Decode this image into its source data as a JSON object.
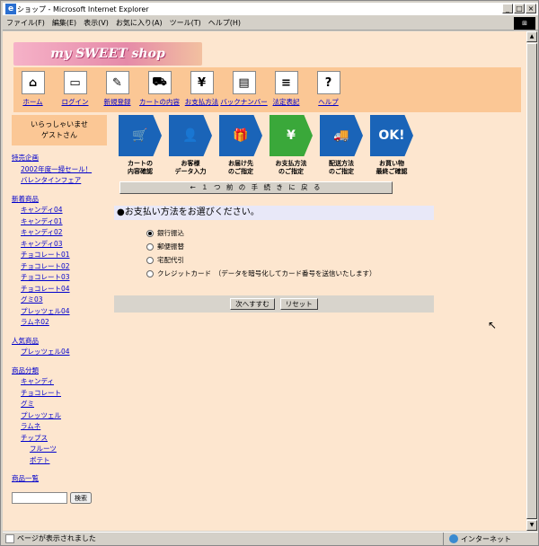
{
  "window": {
    "title": "ショップ - Microsoft Internet Explorer"
  },
  "menu": [
    "ファイル(F)",
    "編集(E)",
    "表示(V)",
    "お気に入り(A)",
    "ツール(T)",
    "ヘルプ(H)"
  ],
  "logo": "my SWEET shop",
  "nav": [
    {
      "label": "ホーム",
      "icon": "house-icon",
      "glyph": "⌂"
    },
    {
      "label": "ログイン",
      "icon": "login-icon",
      "glyph": "▭"
    },
    {
      "label": "新規登録",
      "icon": "register-icon",
      "glyph": "✎"
    },
    {
      "label": "カートの内容",
      "icon": "cart-icon",
      "glyph": "⛟"
    },
    {
      "label": "お支払方法",
      "icon": "payment-icon",
      "glyph": "¥"
    },
    {
      "label": "バックナンバー",
      "icon": "magazine-icon",
      "glyph": "▤"
    },
    {
      "label": "法定表記",
      "icon": "document-icon",
      "glyph": "≡"
    },
    {
      "label": "ヘルプ",
      "icon": "help-icon",
      "glyph": "?"
    }
  ],
  "sidebar": {
    "greet1": "いらっしゃいませ",
    "greet2": "ゲストさん",
    "special_title": "特売企画",
    "special": [
      "2002年度一掃セール！",
      "バレンタインフェア"
    ],
    "new_title": "新着商品",
    "new": [
      "キャンディ04",
      "キャンディ01",
      "キャンディ02",
      "キャンディ03",
      "チョコレート01",
      "チョコレート02",
      "チョコレート03",
      "チョコレート04",
      "グミ03",
      "プレッツェル04",
      "ラムネ02"
    ],
    "popular_title": "人気商品",
    "popular": [
      "プレッツェル04"
    ],
    "category_title": "商品分類",
    "categories": [
      "キャンディ",
      "チョコレート",
      "グミ",
      "プレッツェル",
      "ラムネ",
      "チップス"
    ],
    "subcategories": [
      "フルーツ",
      "ポテト"
    ],
    "all_products": "商品一覧",
    "search_button": "検索"
  },
  "steps": [
    {
      "label1": "カートの",
      "label2": "内容確認",
      "icon": "cart-step-icon",
      "glyph": "🛒",
      "active": false
    },
    {
      "label1": "お客様",
      "label2": "データ入力",
      "icon": "person-step-icon",
      "glyph": "👤",
      "active": false
    },
    {
      "label1": "お届け先",
      "label2": "のご指定",
      "icon": "gift-step-icon",
      "glyph": "🎁",
      "active": false
    },
    {
      "label1": "お支払方法",
      "label2": "のご指定",
      "icon": "card-step-icon",
      "glyph": "¥",
      "active": true
    },
    {
      "label1": "配送方法",
      "label2": "のご指定",
      "icon": "truck-step-icon",
      "glyph": "🚚",
      "active": false
    },
    {
      "label1": "お買い物",
      "label2": "最終ご確認",
      "icon": "ok-step-icon",
      "glyph": "OK!",
      "active": false
    }
  ],
  "back": "← １ つ 前 の 手 続 き に 戻 る",
  "choose": "●お支払い方法をお選びください。",
  "options": [
    {
      "label": "銀行振込",
      "checked": true
    },
    {
      "label": "郵便振替",
      "checked": false
    },
    {
      "label": "宅配代引",
      "checked": false
    },
    {
      "label": "クレジットカード　（データを暗号化してカード番号を送信いたします）",
      "checked": false
    }
  ],
  "buttons": {
    "next": "次へすすむ",
    "reset": "リセット"
  },
  "status": {
    "text": "ページが表示されました",
    "zone": "インターネット"
  }
}
